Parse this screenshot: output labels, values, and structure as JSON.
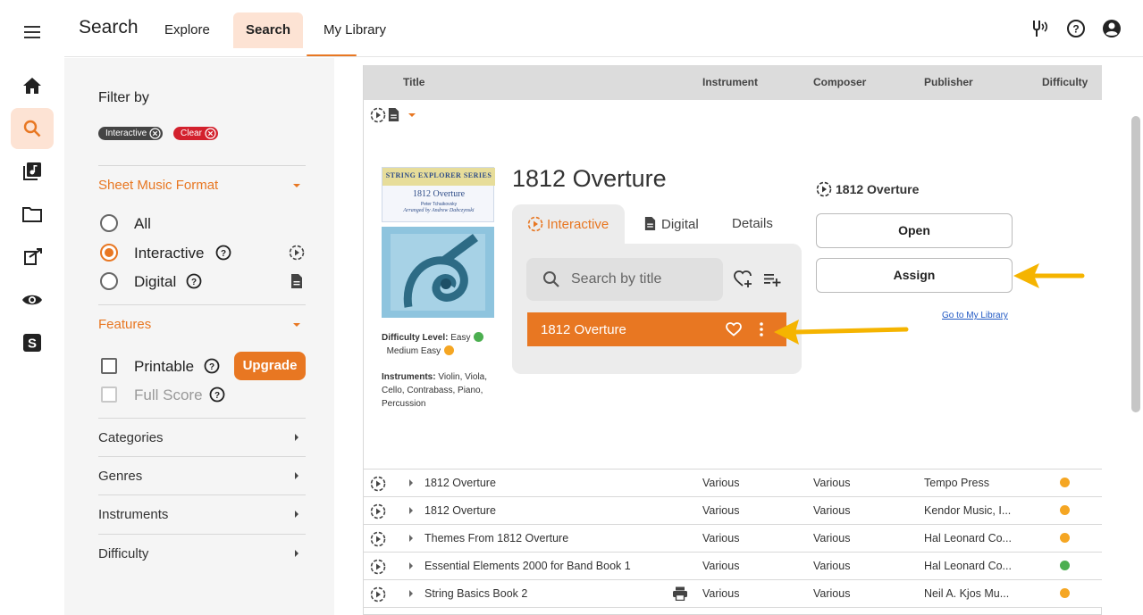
{
  "app": {
    "brand": "Search"
  },
  "nav": {
    "tabs": [
      {
        "label": "Explore"
      },
      {
        "label": "Search"
      },
      {
        "label": "My Library"
      }
    ]
  },
  "filter": {
    "title": "Filter by",
    "chips": [
      {
        "label": "Interactive"
      },
      {
        "label": "Clear"
      }
    ],
    "format": {
      "heading": "Sheet Music Format",
      "options": [
        {
          "label": "All"
        },
        {
          "label": "Interactive"
        },
        {
          "label": "Digital"
        }
      ],
      "selected": "Interactive"
    },
    "features": {
      "heading": "Features",
      "options": [
        {
          "label": "Printable"
        },
        {
          "label": "Full Score"
        }
      ],
      "upgrade_label": "Upgrade"
    },
    "collapsed": [
      {
        "label": "Categories"
      },
      {
        "label": "Genres"
      },
      {
        "label": "Instruments"
      },
      {
        "label": "Difficulty"
      }
    ]
  },
  "table": {
    "headers": [
      "Title",
      "Instrument",
      "Composer",
      "Publisher",
      "Difficulty"
    ],
    "detail": {
      "title": "1812 Overture",
      "cover": {
        "series": "STRING EXPLORER SERIES",
        "title": "1812 Overture",
        "composer": "Peter Tchaikovsky",
        "arranger": "Arranged by Andrew Dabczynski"
      },
      "difficulty_label": "Difficulty Level:",
      "difficulty_value": "Easy",
      "difficulty_value2": "Medium Easy",
      "instruments_label": "Instruments:",
      "instruments_value": "Violin, Viola, Cello, Contrabass, Piano, Percussion",
      "tabs": [
        {
          "label": "Interactive"
        },
        {
          "label": "Digital"
        },
        {
          "label": "Details"
        }
      ],
      "search_placeholder": "Search by title",
      "result_item": "1812 Overture",
      "side_title": "1812 Overture",
      "open_label": "Open",
      "assign_label": "Assign",
      "library_link": "Go to My Library"
    },
    "rows": [
      {
        "title": "1812 Overture",
        "instrument": "Various",
        "composer": "Various",
        "publisher": "Tempo Press",
        "difficulty_color": "#f5a623"
      },
      {
        "title": "1812 Overture",
        "instrument": "Various",
        "composer": "Various",
        "publisher": "Kendor Music, I...",
        "difficulty_color": "#f5a623"
      },
      {
        "title": "Themes From 1812 Overture",
        "instrument": "Various",
        "composer": "Various",
        "publisher": "Hal Leonard Co...",
        "difficulty_color": "#f5a623"
      },
      {
        "title": "Essential Elements 2000 for Band Book 1",
        "instrument": "Various",
        "composer": "Various",
        "publisher": "Hal Leonard Co...",
        "difficulty_color": "#4caf50"
      },
      {
        "title": "String Basics Book 2",
        "instrument": "Various",
        "composer": "Various",
        "publisher": "Neil A. Kjos Mu...",
        "difficulty_color": "#f5a623"
      }
    ]
  },
  "colors": {
    "accent": "#e87722",
    "accent_light": "#fde3d4",
    "arrow": "#f5b400"
  },
  "icons": [
    "menu-icon",
    "home-icon",
    "search-icon",
    "music-library-icon",
    "folder-icon",
    "assign-icon",
    "eye-icon",
    "s-logo-icon",
    "tuning-fork-icon",
    "help-icon",
    "account-icon",
    "interactive-icon",
    "document-icon",
    "heart-add-icon",
    "playlist-add-icon",
    "heart-icon",
    "more-vert-icon",
    "print-icon"
  ]
}
